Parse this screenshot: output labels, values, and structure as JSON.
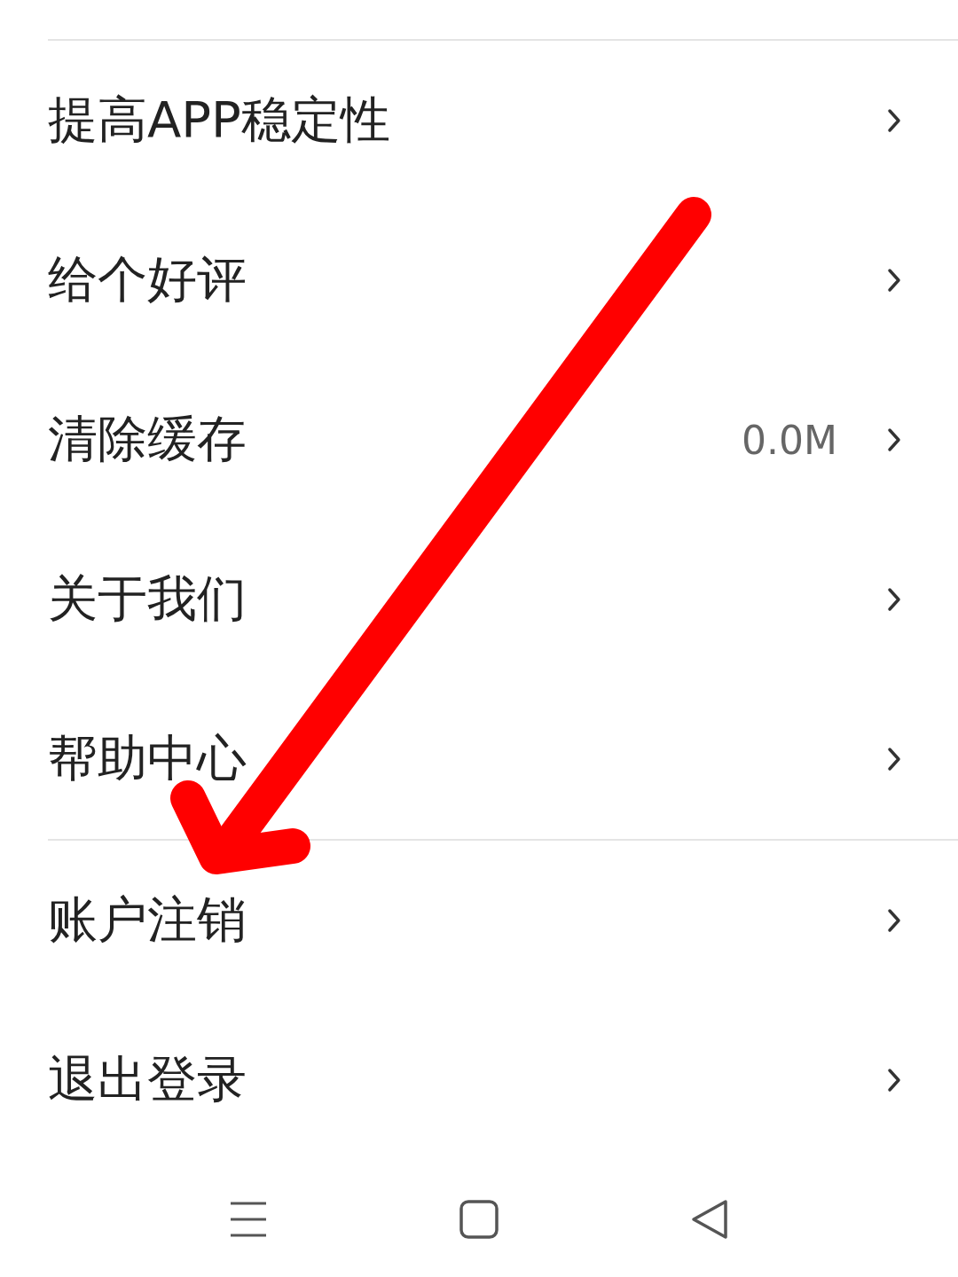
{
  "sections": [
    {
      "items": [
        {
          "label": "提高APP稳定性"
        },
        {
          "label": "给个好评"
        },
        {
          "label": "清除缓存",
          "value": "0.0M"
        },
        {
          "label": "关于我们"
        },
        {
          "label": "帮助中心"
        }
      ]
    },
    {
      "items": [
        {
          "label": "账户注销"
        },
        {
          "label": "退出登录"
        }
      ]
    }
  ],
  "nav_bar": [
    {
      "kind": "menu"
    },
    {
      "kind": "home"
    },
    {
      "kind": "back"
    }
  ],
  "annotations": [
    {
      "kind": "arrow"
    }
  ]
}
